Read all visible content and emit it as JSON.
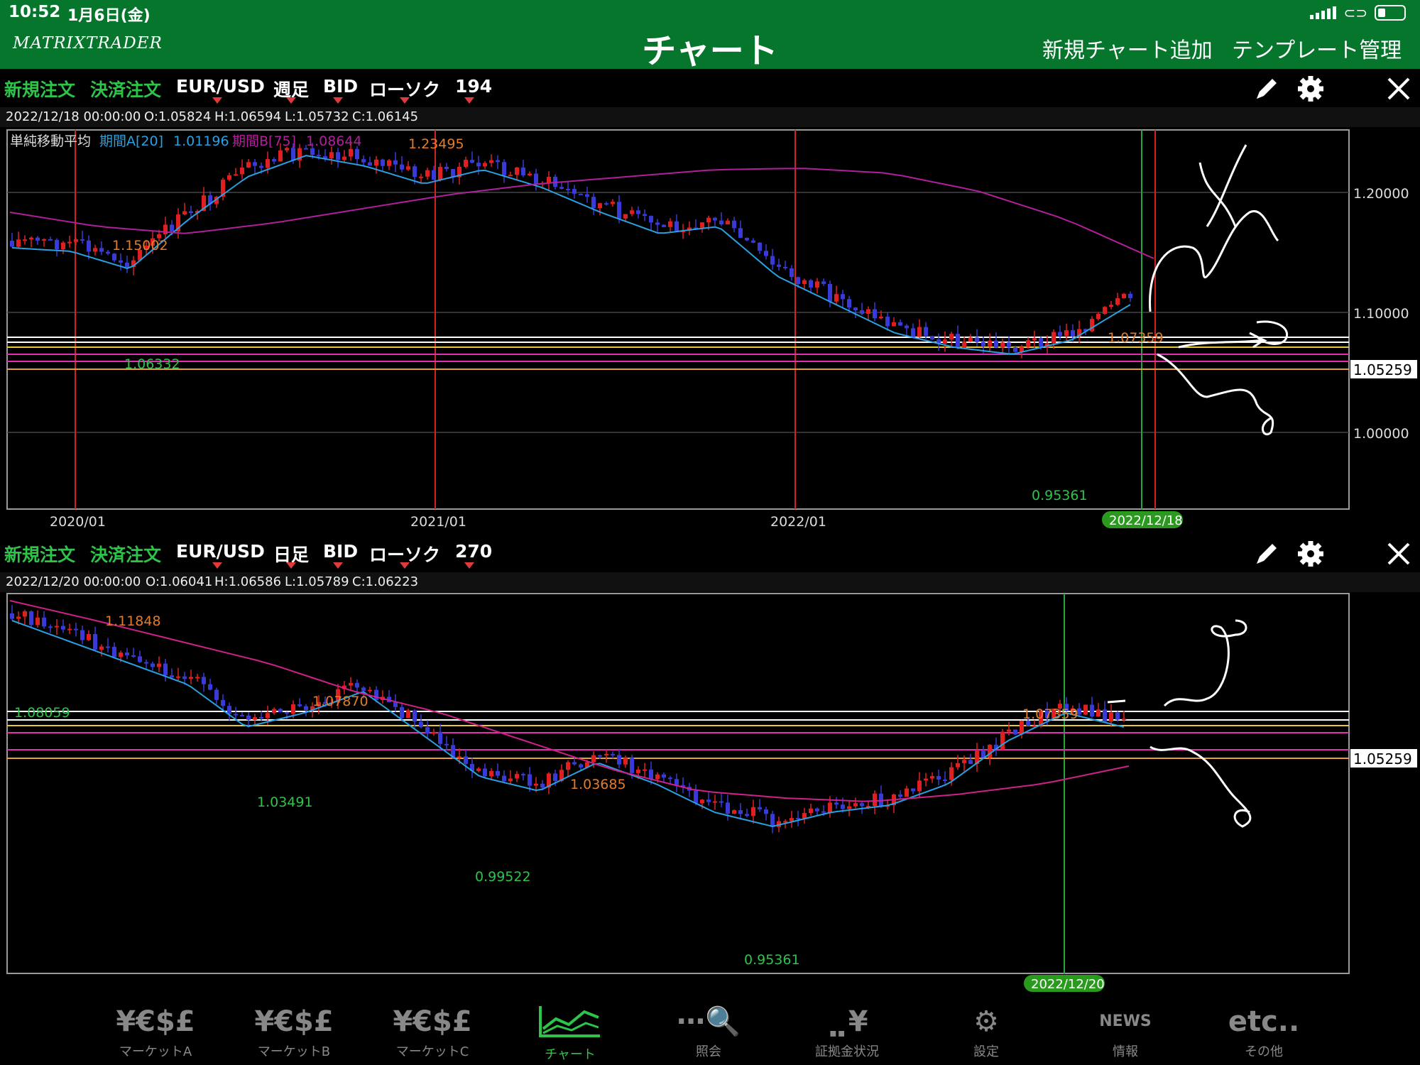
{
  "status": {
    "time": "10:52",
    "date": "1月6日(金)"
  },
  "header": {
    "logo": "MATRIXTRADER",
    "title": "チャート",
    "new_chart": "新規チャート追加",
    "template": "テンプレート管理"
  },
  "charts": [
    {
      "new_order": "新規注文",
      "settle_order": "決済注文",
      "pair": "EUR/USD",
      "period": "週足",
      "side": "BID",
      "style": "ローソク",
      "count": "194",
      "ohlc": {
        "datetime": "2022/12/18 00:00:00",
        "open": "O:1.05824",
        "high": "H:1.06594",
        "low": "L:1.05732",
        "close": "C:1.06145"
      },
      "indicator": {
        "name": "単純移動平均",
        "a_label": "期間A[20]",
        "a_value": "1.01196",
        "b_label": "期間B[75]",
        "b_value": "1.08644"
      },
      "price_axis": [
        "1.20000",
        "1.10000",
        "1.00000"
      ],
      "current_price": "1.05259",
      "time_axis": [
        "2020/01",
        "2021/01",
        "2022/01"
      ],
      "cursor_date": "2022/12/18",
      "annotations": {
        "h1": "1.23495",
        "h2": "1.15002",
        "h3": "1.07359",
        "l1": "1.06332",
        "l2": "0.95361"
      }
    },
    {
      "new_order": "新規注文",
      "settle_order": "決済注文",
      "pair": "EUR/USD",
      "period": "日足",
      "side": "BID",
      "style": "ローソク",
      "count": "270",
      "ohlc": {
        "datetime": "2022/12/20 00:00:00",
        "open": "O:1.06041",
        "high": "H:1.06586",
        "low": "L:1.05789",
        "close": "C:1.06223"
      },
      "current_price": "1.05259",
      "cursor_date": "2022/12/20",
      "annotations": {
        "h1": "1.11848",
        "h2": "1.07870",
        "h3": "1.03685",
        "h4": "1.07359",
        "l1": "1.08059",
        "l2": "1.03491",
        "l3": "0.99522",
        "l4": "0.95361"
      }
    }
  ],
  "nav": [
    {
      "glyph": "¥€$£",
      "label": "マーケットA"
    },
    {
      "glyph": "¥€$£",
      "label": "マーケットB"
    },
    {
      "glyph": "¥€$£",
      "label": "マーケットC"
    },
    {
      "glyph": "〰",
      "label": "チャート"
    },
    {
      "glyph": "⋯🔍",
      "label": "照会"
    },
    {
      "glyph": "⣀¥",
      "label": "証拠金状況"
    },
    {
      "glyph": "⚙",
      "label": "設定"
    },
    {
      "glyph": "NEWS",
      "label": "情報"
    },
    {
      "glyph": "etc..",
      "label": "その他"
    }
  ],
  "colors": {
    "header_bg": "#06762c",
    "bull": "#e02020",
    "bear": "#3a3ad8",
    "ma_a": "#2aa0e0",
    "ma_b": "#b0209a",
    "accent": "#2ec44a"
  }
}
